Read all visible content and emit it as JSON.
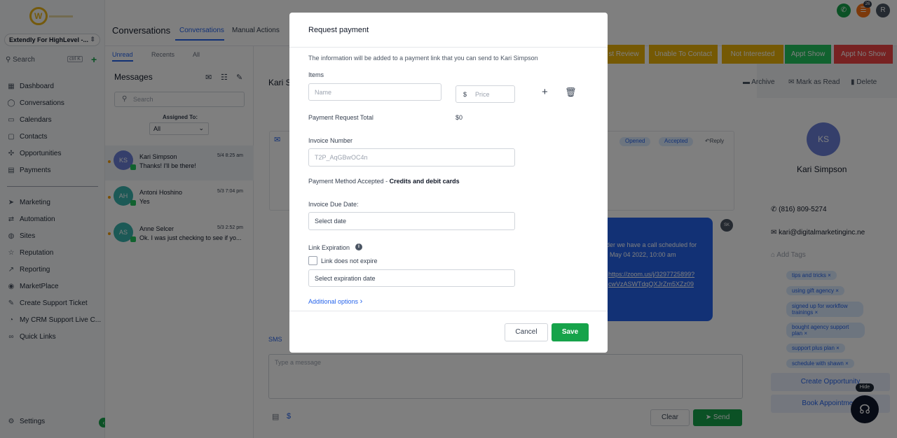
{
  "colors": {
    "accent": "#2563eb",
    "success": "#16a34a",
    "overlay": "rgba(0,0,0,0.5)"
  },
  "sidebar": {
    "account": "Extendly For HighLevel -...",
    "search_label": "Search",
    "search_shortcut": "ctrl K",
    "items": [
      {
        "label": "Dashboard",
        "icon": "dashboard-icon"
      },
      {
        "label": "Conversations",
        "icon": "chat-icon"
      },
      {
        "label": "Calendars",
        "icon": "calendar-icon"
      },
      {
        "label": "Contacts",
        "icon": "contacts-icon"
      },
      {
        "label": "Opportunities",
        "icon": "opportunities-icon"
      },
      {
        "label": "Payments",
        "icon": "payments-icon"
      }
    ],
    "items2": [
      {
        "label": "Marketing",
        "icon": "send-icon"
      },
      {
        "label": "Automation",
        "icon": "automation-icon"
      },
      {
        "label": "Sites",
        "icon": "globe-icon"
      },
      {
        "label": "Reputation",
        "icon": "star-icon"
      },
      {
        "label": "Reporting",
        "icon": "chart-icon"
      },
      {
        "label": "MarketPlace",
        "icon": "marketplace-icon"
      },
      {
        "label": "Create Support Ticket",
        "icon": "wrench-icon"
      },
      {
        "label": "My CRM Support Live C...",
        "icon": "support-icon"
      },
      {
        "label": "Quick Links",
        "icon": "link-icon"
      }
    ],
    "settings": "Settings"
  },
  "topbar": {
    "title": "Conversations",
    "tabs": [
      "Conversations",
      "Manual Actions"
    ],
    "badge_count": "26",
    "user_initial": "R"
  },
  "list": {
    "sub_tabs": [
      "Unread",
      "Recents",
      "All"
    ],
    "messages_title": "Messages",
    "search_placeholder": "Search",
    "assigned_to_label": "Assigned To:",
    "assigned_to_value": "All",
    "conversations": [
      {
        "initials": "KS",
        "name": "Kari Simpson",
        "time": "5/4 8:25 am",
        "preview": "Thanks! I'll be there!",
        "avatar_color": "#6b7fd6"
      },
      {
        "initials": "AH",
        "name": "Antoni Hoshino",
        "time": "5/3 7:04 pm",
        "preview": "Yes",
        "avatar_color": "#38b2ac"
      },
      {
        "initials": "AS",
        "name": "Anne Selcer",
        "time": "5/3 2:52 pm",
        "preview": "Ok. I was just checking to see if yo...",
        "avatar_color": "#38b2ac"
      }
    ]
  },
  "center": {
    "contact_name": "Kari S",
    "action_buttons": [
      {
        "label": "st Review",
        "color": "#eab308"
      },
      {
        "label": "Unable To Contact",
        "color": "#eab308"
      },
      {
        "label": "Not Interested",
        "color": "#eab308"
      },
      {
        "label": "Appt Show",
        "color": "#22c55e"
      },
      {
        "label": "Appt No Show",
        "color": "#ef4444"
      }
    ],
    "header_actions": [
      "Archive",
      "Mark as Read",
      "Delete"
    ],
    "email_tags": [
      "Opened",
      "Accepted"
    ],
    "reply_label": "Reply",
    "bubble_lines": [
      "nder we have a call scheduled for",
      "May 04 2022, 10:00 am",
      "https://zoom.us/j/3297725899?",
      "cwVzASWTdqQXJrZm5XZz09"
    ],
    "bubble_avatar": "SK",
    "sms_tab": "SMS",
    "compose_placeholder": "Type a message",
    "clear_label": "Clear",
    "send_label": "Send"
  },
  "contact": {
    "initials": "KS",
    "name": "Kari Simpson",
    "phone": "(816) 809-5274",
    "email": "kari@digitalmarketinginc.ne",
    "add_tags_placeholder": "Add Tags",
    "tags": [
      "tips and tricks",
      "using gift agency",
      "signed up for workflow trainings",
      "bought agency support plan",
      "support plus plan",
      "schedule with shawn"
    ],
    "create_opportunity": "Create Opportunity",
    "book_appointment": "Book Appointment",
    "hide_label": "Hide"
  },
  "modal": {
    "title": "Request payment",
    "description": "The information will be added to a payment link that you can send to Kari Simpson",
    "items_label": "Items",
    "name_placeholder": "Name",
    "currency_symbol": "$",
    "price_placeholder": "Price",
    "total_label": "Payment Request Total",
    "total_value": "$0",
    "invoice_number_label": "Invoice Number",
    "invoice_number_value": "T2P_AqGBwOC4n",
    "payment_method_label": "Payment Method Accepted - ",
    "payment_method_value": "Credits and debit cards",
    "due_date_label": "Invoice Due Date:",
    "due_date_placeholder": "Select date",
    "link_expiration_label": "Link Expiration",
    "no_expire_label": "Link does not expire",
    "expiration_placeholder": "Select expiration date",
    "additional_options": "Additional options",
    "cancel_label": "Cancel",
    "save_label": "Save"
  }
}
